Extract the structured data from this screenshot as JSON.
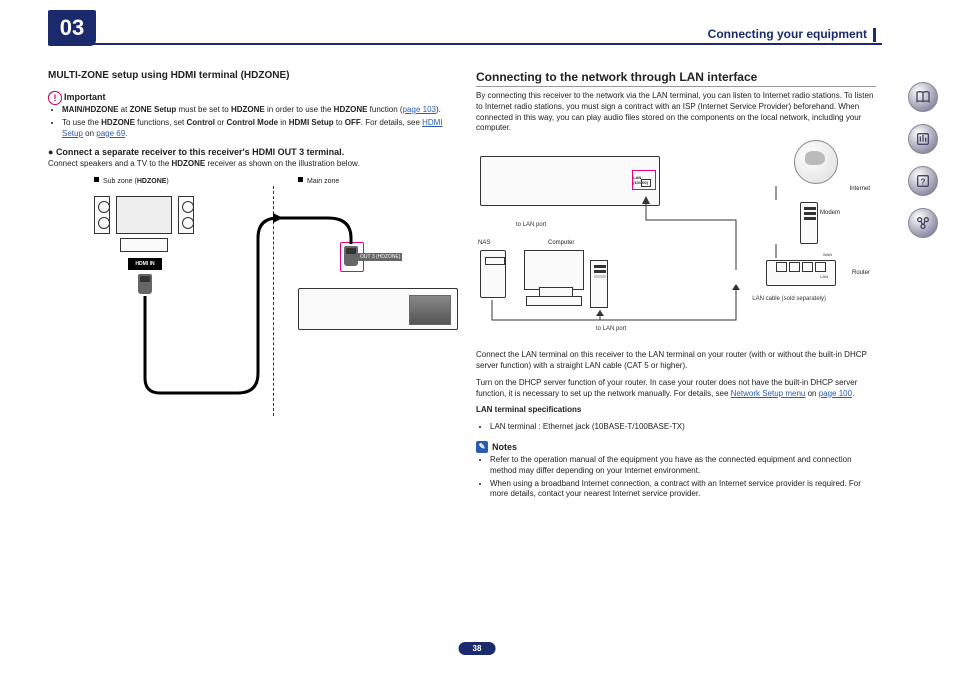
{
  "chapter_number": "03",
  "section_title": "Connecting your equipment",
  "page_number": "38",
  "left": {
    "heading": "MULTI-ZONE setup using HDMI terminal (HDZONE)",
    "important_label": "Important",
    "bullets": [
      {
        "pre": "",
        "b1": "MAIN/HDZONE",
        "t1": " at ",
        "b2": "ZONE Setup",
        "t2": " must be set to ",
        "b3": "HDZONE",
        "t3": " in order to use the ",
        "b4": "HDZONE",
        "t4": " function (",
        "link": "page 103",
        "t5": ")."
      },
      {
        "pre": "To use the ",
        "b1": "HDZONE",
        "t1": " functions, set ",
        "b2": "Control",
        "t2": " or ",
        "b3": "Control Mode",
        "t3": " in ",
        "b4": "HDMI Setup",
        "t4": " to ",
        "b5": "OFF",
        "t5": ". For details, see ",
        "link": "HDMI Setup",
        "t6": " on ",
        "link2": "page 69",
        "t7": "."
      }
    ],
    "connect_heading": "Connect a separate receiver to this receiver's HDMI OUT 3 terminal.",
    "connect_text_pre": "Connect speakers and a TV to the ",
    "connect_text_b": "HDZONE",
    "connect_text_post": " receiver as shown on the illustration below.",
    "diagram": {
      "sub_zone_pre": "Sub zone (",
      "sub_zone_b": "HDZONE",
      "sub_zone_post": ")",
      "main_zone": "Main zone",
      "hdmi_in": "HDMI IN",
      "out3": "OUT 3 (HDZONE)"
    }
  },
  "right": {
    "heading": "Connecting to the network through LAN interface",
    "intro": "By connecting this receiver to the network via the LAN terminal, you can listen to Internet radio stations. To listen to Internet radio stations, you must sign a contract with an ISP (Internet Service Provider) beforehand. When connected in this way, you can play audio files stored on the components on the local network, including your computer.",
    "diagram": {
      "lan_port": "LAN (10/100)",
      "internet": "Internet",
      "modem": "Modem",
      "router": "Router",
      "nas": "NAS",
      "computer": "Computer",
      "to_lan_port": "to LAN port",
      "lan_cable": "LAN cable (sold separately)",
      "lan_lbl": "LAN",
      "wan_lbl": "WAN"
    },
    "connect_para": "Connect the LAN terminal on this receiver to the LAN terminal on your router (with or without the built-in DHCP server function) with a straight LAN cable (CAT 5 or higher).",
    "dhcp_para_pre": "Turn on the DHCP server function of your router. In case your router does not have the built-in DHCP server function, it is necessary to set up the network manually. For details, see ",
    "dhcp_link1": "Network Setup menu",
    "dhcp_mid": " on ",
    "dhcp_link2": "page 100",
    "dhcp_post": ".",
    "spec_heading": "LAN terminal specifications",
    "spec_bullet": "LAN terminal : Ethernet jack (10BASE-T/100BASE-TX)",
    "notes_label": "Notes",
    "notes": [
      "Refer to the operation manual of the equipment you have as the connected equipment and connection method may differ depending on your Internet environment.",
      "When using a broadband Internet connection, a contract with an Internet service provider is required. For more details, contact your nearest Internet service provider."
    ]
  },
  "nav": {
    "book": "book-open-icon",
    "controls": "sliders-icon",
    "help": "help-icon",
    "network": "network-icon"
  }
}
